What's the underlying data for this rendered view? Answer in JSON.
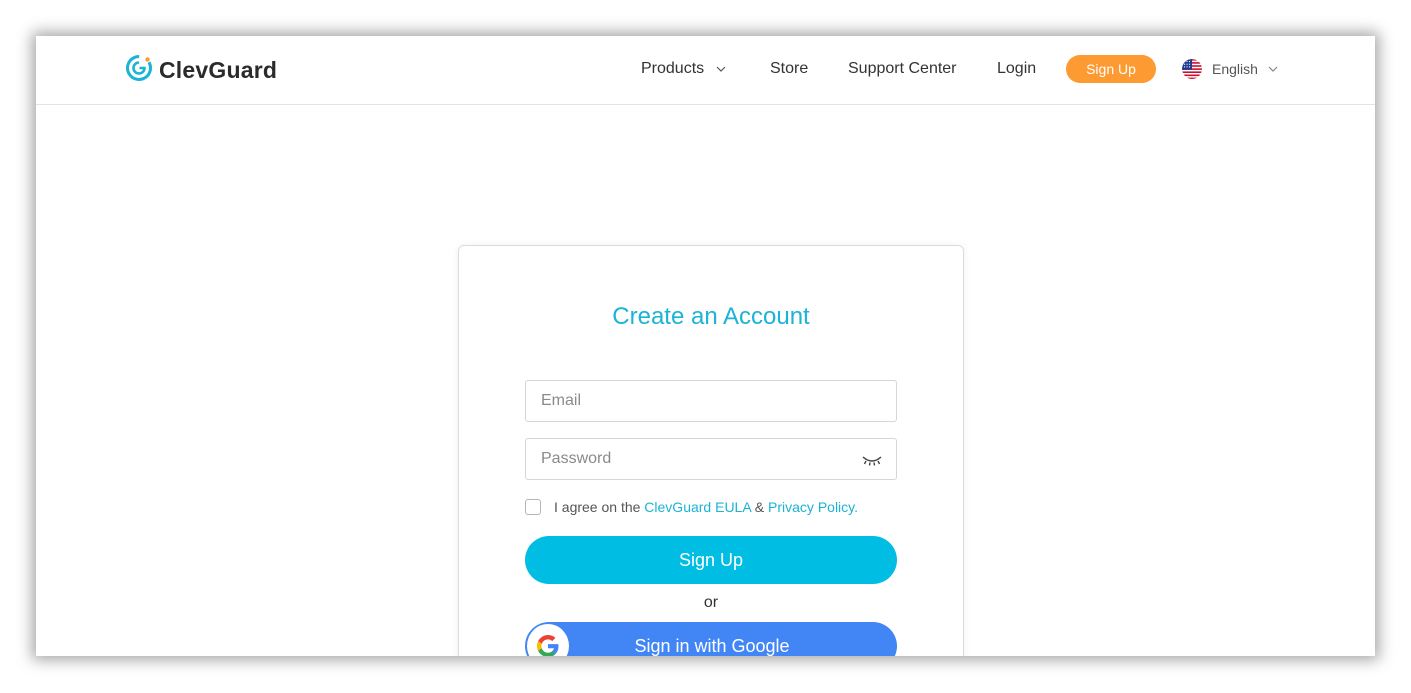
{
  "header": {
    "logo_text": "ClevGuard",
    "nav": {
      "products": "Products",
      "store": "Store",
      "support": "Support Center",
      "login": "Login"
    },
    "signup_label": "Sign Up",
    "language": "English"
  },
  "form": {
    "title": "Create an Account",
    "email_placeholder": "Email",
    "password_placeholder": "Password",
    "agree_prefix": "I agree on the ",
    "eula_link": "ClevGuard EULA",
    "amp": " & ",
    "privacy_link": "Privacy Policy",
    "agree_suffix": ".",
    "signup_button": "Sign Up",
    "or_text": "or",
    "google_button": "Sign in with Google"
  },
  "colors": {
    "brand": "#1bb3d6",
    "signup_pill": "#fd9a31",
    "primary_button": "#00bde3",
    "google_button": "#4285f4"
  },
  "icons": {
    "logo": "clevguard-logo-icon",
    "flag": "us-flag-icon",
    "password_toggle": "eye-closed-icon",
    "google": "google-g-icon"
  }
}
